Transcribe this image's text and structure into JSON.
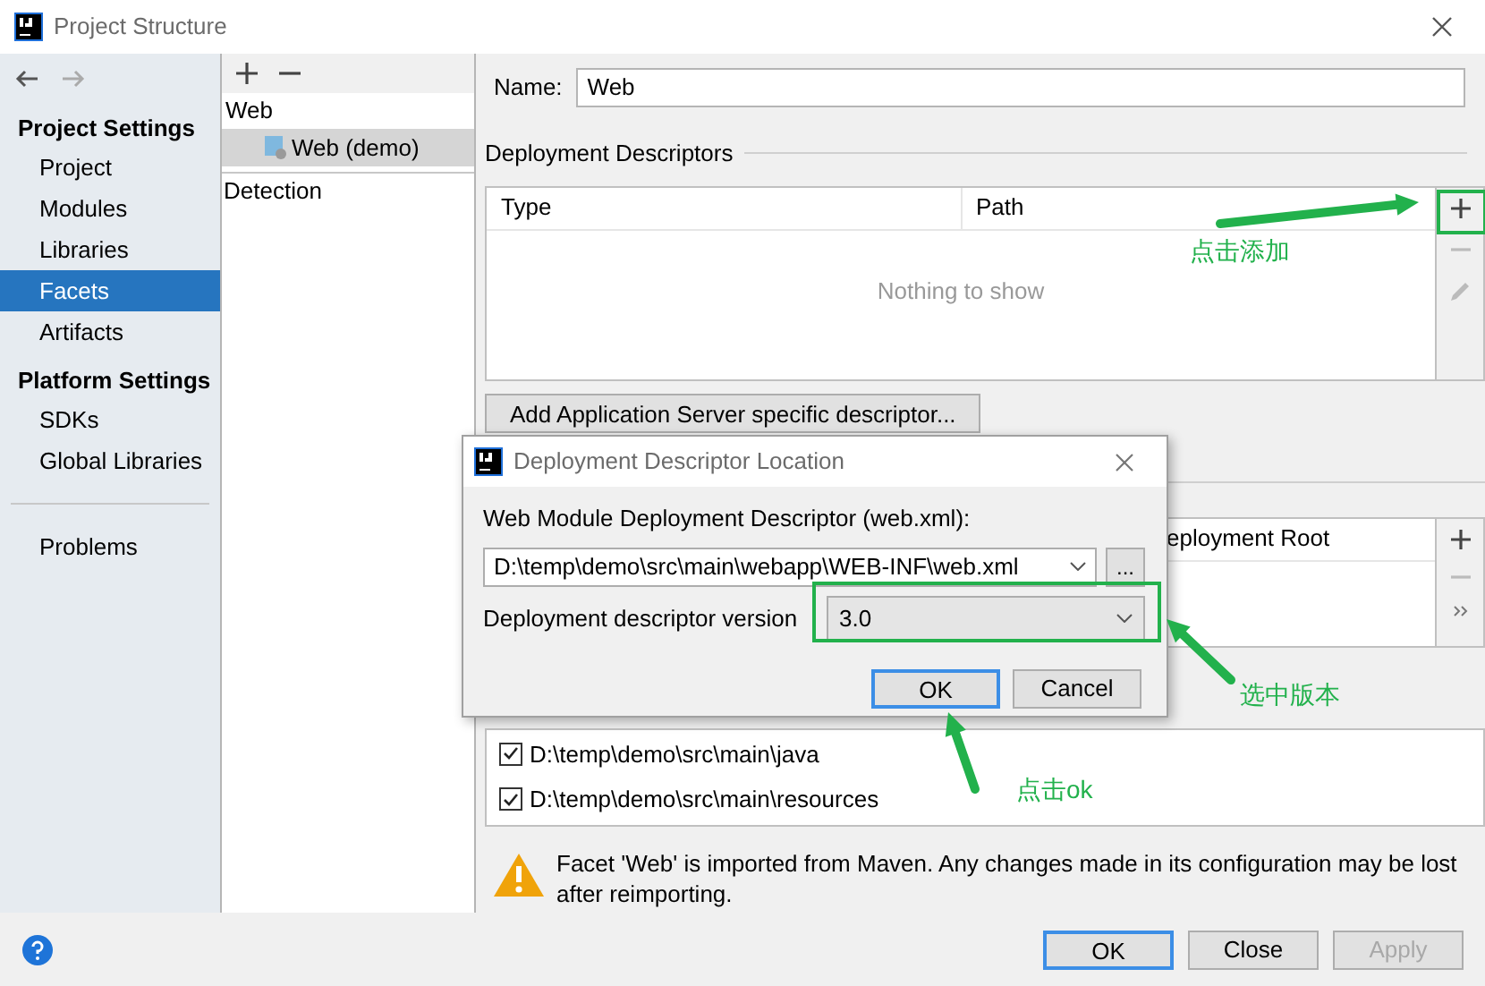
{
  "window": {
    "title": "Project Structure"
  },
  "sidebar": {
    "groups": [
      {
        "title": "Project Settings",
        "items": [
          {
            "label": "Project",
            "selected": false
          },
          {
            "label": "Modules",
            "selected": false
          },
          {
            "label": "Libraries",
            "selected": false
          },
          {
            "label": "Facets",
            "selected": true
          },
          {
            "label": "Artifacts",
            "selected": false
          }
        ]
      },
      {
        "title": "Platform Settings",
        "items": [
          {
            "label": "SDKs",
            "selected": false
          },
          {
            "label": "Global Libraries",
            "selected": false
          }
        ]
      }
    ],
    "extra_items": [
      {
        "label": "Problems",
        "selected": false
      }
    ]
  },
  "facet_tree": {
    "items": [
      {
        "label": "Web",
        "selected": false,
        "children": [
          {
            "label": "Web (demo)",
            "selected": true
          }
        ]
      }
    ],
    "detection": "Detection"
  },
  "facet": {
    "name_label": "Name:",
    "name_value": "Web",
    "descriptors": {
      "title": "Deployment Descriptors",
      "columns": [
        "Type",
        "Path"
      ],
      "empty_text": "Nothing to show"
    },
    "add_server_button": "Add Application Server specific descriptor...",
    "resources": {
      "visible_header": "eployment Root"
    },
    "source_roots": [
      {
        "label": "D:\\temp\\demo\\src\\main\\java",
        "checked": true
      },
      {
        "label": "D:\\temp\\demo\\src\\main\\resources",
        "checked": true
      }
    ],
    "warning": "Facet 'Web' is imported from Maven. Any changes made in its configuration may be lost after reimporting."
  },
  "buttons": [
    {
      "label": "OK",
      "kind": "default",
      "disabled": false
    },
    {
      "label": "Close",
      "kind": "normal",
      "disabled": false
    },
    {
      "label": "Apply",
      "kind": "normal",
      "disabled": true
    }
  ],
  "dialog": {
    "title": "Deployment Descriptor Location",
    "path_label": "Web Module Deployment Descriptor (web.xml):",
    "path_value": "D:\\temp\\demo\\src\\main\\webapp\\WEB-INF\\web.xml",
    "browse_button": "...",
    "version_label": "Deployment descriptor version",
    "version_value": "3.0",
    "buttons": [
      {
        "label": "OK",
        "kind": "default"
      },
      {
        "label": "Cancel",
        "kind": "normal"
      }
    ]
  },
  "annotations": [
    {
      "text": "点击添加"
    },
    {
      "text": "选中版本"
    },
    {
      "text": "点击ok"
    }
  ]
}
